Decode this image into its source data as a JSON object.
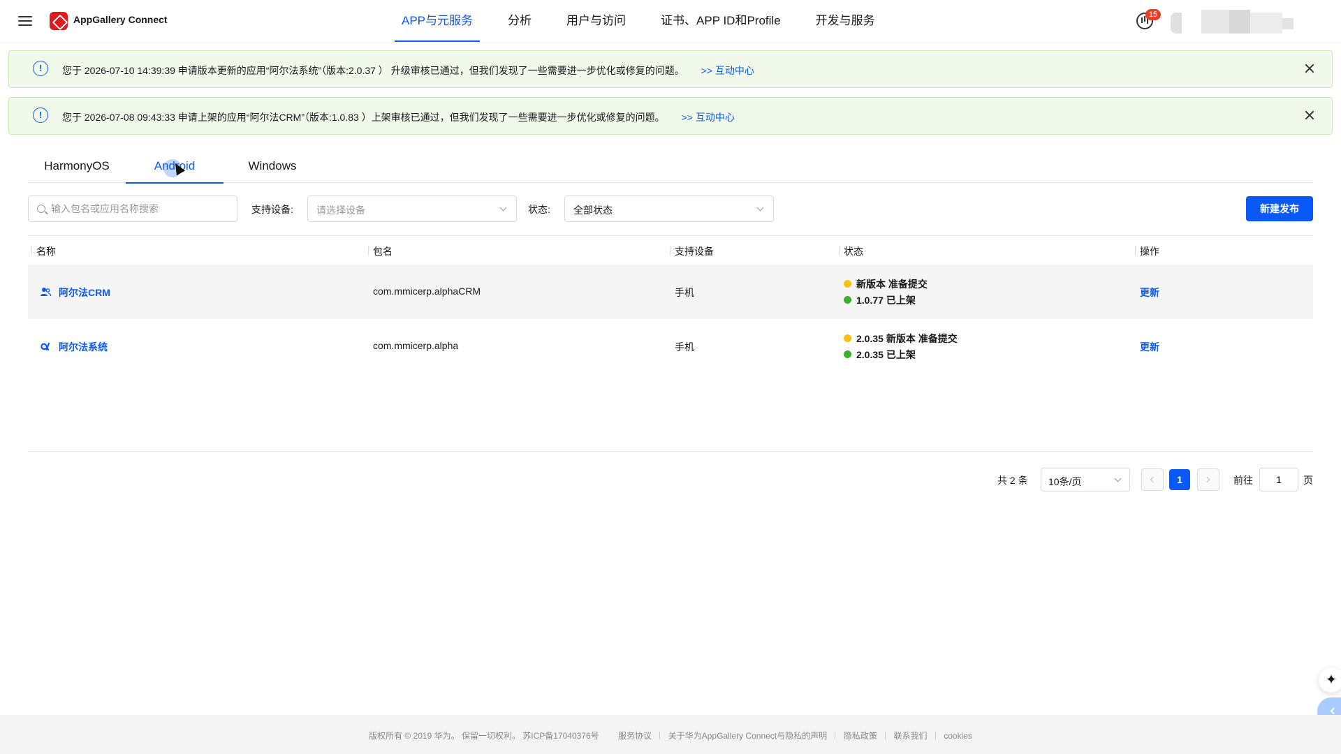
{
  "header": {
    "brand": "AppGallery Connect",
    "nav": [
      {
        "label": "APP与元服务",
        "active": true
      },
      {
        "label": "分析",
        "active": false
      },
      {
        "label": "用户与访问",
        "active": false
      },
      {
        "label": "证书、APP ID和Profile",
        "active": false
      },
      {
        "label": "开发与服务",
        "active": false
      }
    ],
    "notification_count": "15"
  },
  "notices": [
    {
      "text": "您于 2026-07-10 14:39:39 申请版本更新的应用“阿尔法系统”（版本:2.0.37 ） 升级审核已通过，但我们发现了一些需要进一步优化或修复的问题。",
      "link": ">> 互动中心"
    },
    {
      "text": "您于 2026-07-08 09:43:33 申请上架的应用“阿尔法CRM”（版本:1.0.83 ）上架审核已通过，但我们发现了一些需要进一步优化或修复的问题。",
      "link": ">> 互动中心"
    }
  ],
  "platform_tabs": [
    {
      "label": "HarmonyOS",
      "active": false
    },
    {
      "label": "Android",
      "active": true
    },
    {
      "label": "Windows",
      "active": false
    }
  ],
  "filters": {
    "search_placeholder": "输入包名或应用名称搜索",
    "device_label": "支持设备:",
    "device_placeholder": "请选择设备",
    "status_label": "状态:",
    "status_value": "全部状态",
    "new_button": "新建发布"
  },
  "table": {
    "columns": [
      "名称",
      "包名",
      "支持设备",
      "状态",
      "操作"
    ],
    "rows": [
      {
        "name": "阿尔法CRM",
        "icon": "users-icon",
        "package": "com.mmicerp.alphaCRM",
        "device": "手机",
        "status": [
          {
            "color": "#fbbf14",
            "text": "新版本 准备提交"
          },
          {
            "color": "#38b12c",
            "text": "1.0.77 已上架"
          }
        ],
        "action": "更新"
      },
      {
        "name": "阿尔法系统",
        "icon": "alpha-icon",
        "package": "com.mmicerp.alpha",
        "device": "手机",
        "status": [
          {
            "color": "#fbbf14",
            "text": "2.0.35 新版本 准备提交"
          },
          {
            "color": "#38b12c",
            "text": "2.0.35 已上架"
          }
        ],
        "action": "更新"
      }
    ]
  },
  "pagination": {
    "total": "共 2 条",
    "page_size": "10条/页",
    "current_page": "1",
    "goto_label": "前往",
    "goto_value": "1",
    "page_suffix": "页"
  },
  "footer": {
    "copyright": "版权所有 © 2019 华为。 保留一切权利。 苏ICP备17040376号",
    "links": [
      "服务协议",
      "关于华为AppGallery Connect与隐私的声明",
      "隐私政策",
      "联系我们",
      "cookies"
    ]
  },
  "colors": {
    "primary": "#0a59f7",
    "notice_bg": "#f1faea",
    "badge": "#e84026"
  }
}
